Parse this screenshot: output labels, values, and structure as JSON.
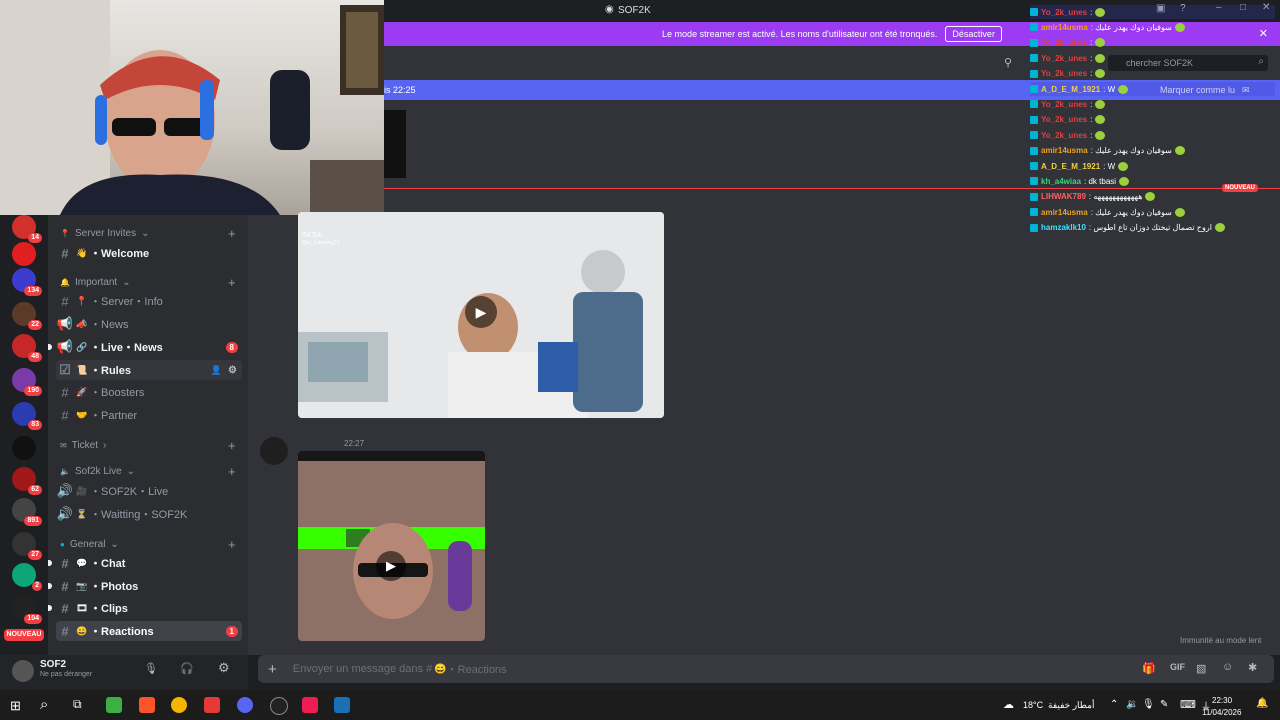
{
  "window": {
    "title": "SOF2K"
  },
  "banner": {
    "text": "Le mode streamer est activé. Les noms d'utilisateur ont été tronqués.",
    "button": "Désactiver"
  },
  "new_messages": {
    "time": "is 22:25",
    "mark_read": "Marquer comme lu"
  },
  "search": {
    "placeholder": "chercher SOF2K"
  },
  "new_badge": "NOUVEAU",
  "servers": [
    {
      "badge": "14"
    },
    {
      "badge": ""
    },
    {
      "badge": "134"
    },
    {
      "badge": "22"
    },
    {
      "badge": "48"
    },
    {
      "badge": "190"
    },
    {
      "badge": "83"
    },
    {
      "badge": ""
    },
    {
      "badge": "62"
    },
    {
      "badge": "891"
    },
    {
      "badge": "27"
    },
    {
      "badge": "2"
    },
    {
      "badge": "104"
    }
  ],
  "server_new_label": "NOUVEAU",
  "categories": {
    "invites": "Server Invites",
    "important": "Important",
    "ticket": "Ticket",
    "live": "Sof2k Live",
    "general": "General"
  },
  "channels": {
    "welcome": "・Welcome",
    "server_info": "・Server・Info",
    "news": "・News",
    "live_news": "・Live・News",
    "live_news_badge": "8",
    "rules": "・Rules",
    "boosters": "・Boosters",
    "partner": "・Partner",
    "sof2k_live": "・SOF2K・Live",
    "waiting": "・Waitting・SOF2K",
    "chat": "・Chat",
    "photos": "・Photos",
    "clips": "・Clips",
    "reactions": "・Reactions",
    "reactions_badge": "1"
  },
  "user": {
    "name": "SOF2",
    "status": "Ne pas déranger"
  },
  "messages": [
    {
      "author": "",
      "time": "22:27"
    }
  ],
  "video1": {
    "overlay_brand": "TikTok",
    "overlay_handle": "@el_sohawey23"
  },
  "composer": {
    "placeholder": "Envoyer un message dans #",
    "channel": "・Reactions"
  },
  "slowmode": "Immunité au mode lent",
  "chat_overlay": [
    {
      "user": "Yo_2k_unes",
      "msg": ":",
      "color": "#e04040"
    },
    {
      "user": "amir14usma",
      "msg": ": سوفيان دوك يهدر عليك",
      "color": "#f0a020"
    },
    {
      "user": "Yo_2k_unes",
      "msg": ":",
      "color": "#e04040"
    },
    {
      "user": "Yo_2k_unes",
      "msg": ":",
      "color": "#e04040"
    },
    {
      "user": "Yo_2k_unes",
      "msg": ":",
      "color": "#e04040"
    },
    {
      "user": "A_D_E_M_1921",
      "msg": ": W",
      "color": "#f0d040"
    },
    {
      "user": "Yo_2k_unes",
      "msg": ":",
      "color": "#e04040"
    },
    {
      "user": "Yo_2k_unes",
      "msg": ":",
      "color": "#e04040"
    },
    {
      "user": "Yo_2k_unes",
      "msg": ":",
      "color": "#e04040"
    },
    {
      "user": "amir14usma",
      "msg": ": سوفيان دوك يهدر عليك",
      "color": "#f0a020"
    },
    {
      "user": "A_D_E_M_1921",
      "msg": ": W",
      "color": "#f0d040"
    },
    {
      "user": "kh_a4wiaa",
      "msg": ": dk tbasi",
      "color": "#40d080"
    },
    {
      "user": "LIHWAK789",
      "msg": ": ههههههههههههه",
      "color": "#ff6060"
    },
    {
      "user": "amir14usma",
      "msg": ": سوفيان دوك يهدر عليك",
      "color": "#f0a020"
    },
    {
      "user": "hamzaklk10",
      "msg": ": اروح تصمال تيختك دوزان تاع اطوس",
      "color": "#40e0ff"
    }
  ],
  "taskbar": {
    "weather": "18°C",
    "weather_desc": "أمطار خفيفة",
    "time": "22:30",
    "date": "11/04/2026"
  },
  "colors": {
    "accent": "#5865f2",
    "banner": "#9b3cf2",
    "danger": "#f23f43"
  }
}
